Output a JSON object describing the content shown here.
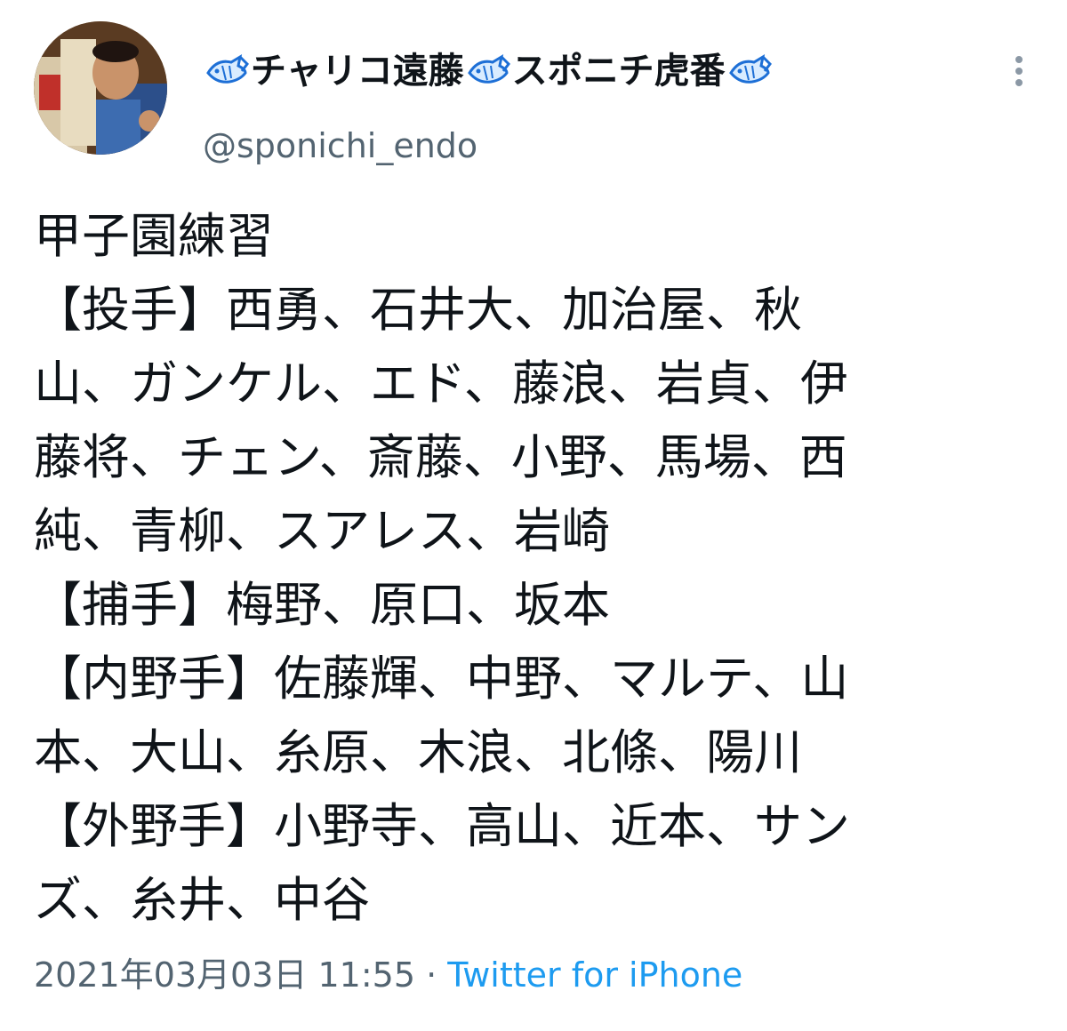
{
  "author": {
    "name_parts": [
      "チャリコ遠藤",
      "スポニチ虎番"
    ],
    "handle": "@sponichi_endo",
    "name_icon": "tuna-fish-icon",
    "icon_color": "#1d6fd6"
  },
  "tweet": {
    "lines": [
      "甲子園練習",
      "【投手】西勇、石井大、加治屋、秋",
      "山、ガンケル、エド、藤浪、岩貞、伊",
      "藤将、チェン、斎藤、小野、馬場、西",
      "純、青柳、スアレス、岩崎",
      "【捕手】梅野、原口、坂本",
      "【内野手】佐藤輝、中野、マルテ、山",
      "本、大山、糸原、木浪、北條、陽川",
      "【外野手】小野寺、高山、近本、サン",
      "ズ、糸井、中谷"
    ]
  },
  "meta": {
    "timestamp": "2021年03月03日 11:55",
    "separator": " · ",
    "source": "Twitter for iPhone"
  },
  "colors": {
    "text": "#0f1419",
    "secondary": "#536471",
    "link": "#1d9bf0"
  }
}
